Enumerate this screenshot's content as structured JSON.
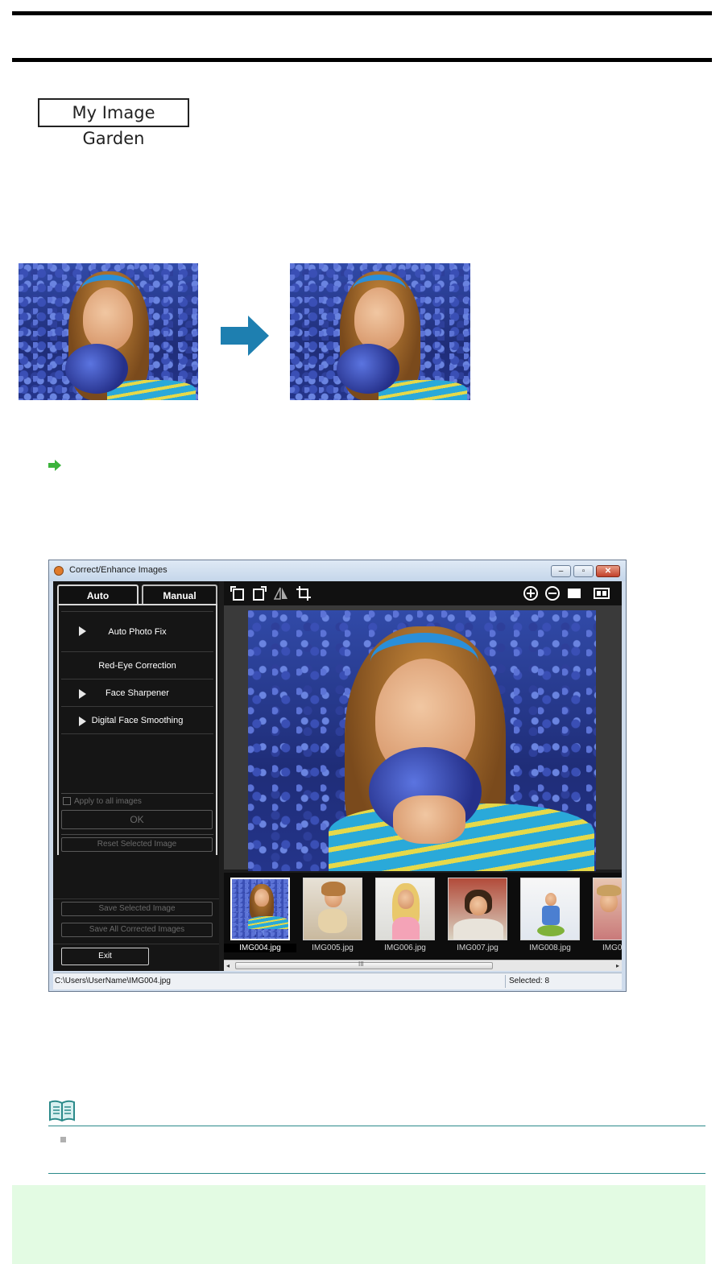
{
  "badge": {
    "label": "My Image Garden"
  },
  "window": {
    "title": "Correct/Enhance Images",
    "tabs": [
      {
        "label": "Auto",
        "active": true
      },
      {
        "label": "Manual",
        "active": false
      }
    ],
    "corrections": [
      {
        "label": "Auto Photo Fix",
        "expandable": true
      },
      {
        "label": "Red-Eye Correction",
        "expandable": false
      },
      {
        "label": "Face Sharpener",
        "expandable": true
      },
      {
        "label": "Digital Face Smoothing",
        "expandable": true
      }
    ],
    "apply_all_label": "Apply to all images",
    "ok_label": "OK",
    "reset_label": "Reset Selected Image",
    "save_selected_label": "Save Selected Image",
    "save_all_label": "Save All Corrected Images",
    "exit_label": "Exit",
    "toolbar_icons": [
      "rotate-left-icon",
      "rotate-right-icon",
      "flip-icon",
      "crop-icon",
      "zoom-in-icon",
      "zoom-out-icon",
      "full-screen-icon",
      "compare-icon"
    ],
    "thumbnails": [
      {
        "name": "IMG004.jpg",
        "selected": true
      },
      {
        "name": "IMG005.jpg",
        "selected": false
      },
      {
        "name": "IMG006.jpg",
        "selected": false
      },
      {
        "name": "IMG007.jpg",
        "selected": false
      },
      {
        "name": "IMG008.jpg",
        "selected": false
      },
      {
        "name": "IMG0",
        "selected": false
      }
    ],
    "scroll_grip": "III",
    "status_path": "C:\\Users\\UserName\\IMG004.jpg",
    "status_selected": "Selected: 8"
  },
  "colors": {
    "arrow": "#1e7fb0",
    "link_arrow": "#3bb33b",
    "note_accent": "#2b8a8a",
    "footer_bg": "#e3fbe3"
  }
}
